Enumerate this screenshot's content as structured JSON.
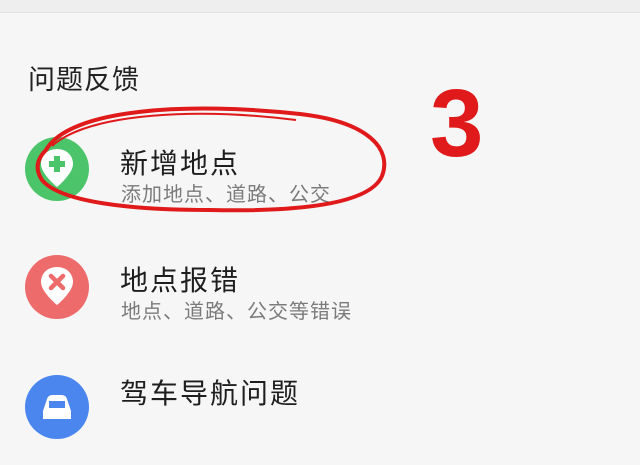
{
  "section": {
    "title": "问题反馈"
  },
  "annotation": {
    "number": "3"
  },
  "items": [
    {
      "title": "新增地点",
      "subtitle": "添加地点、道路、公交",
      "icon": "add-location-icon",
      "color": "#4cc46a"
    },
    {
      "title": "地点报错",
      "subtitle": "地点、道路、公交等错误",
      "icon": "location-error-icon",
      "color": "#ee6b6b"
    },
    {
      "title": "驾车导航问题",
      "subtitle": "",
      "icon": "car-icon",
      "color": "#4a86ee"
    }
  ]
}
